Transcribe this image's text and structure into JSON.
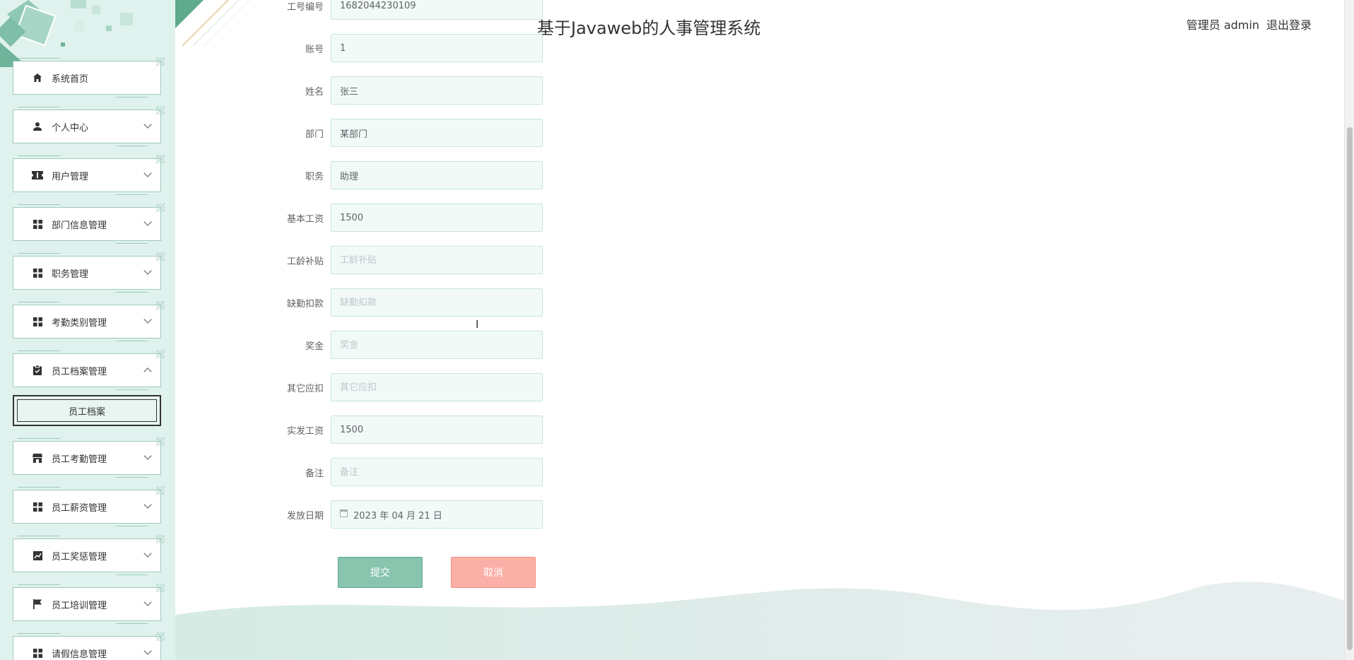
{
  "header": {
    "title": "基于Javaweb的人事管理系统",
    "user_label": "管理员 admin",
    "logout_label": "退出登录"
  },
  "sidebar": {
    "items": [
      {
        "label": "系统首页",
        "icon": "home-icon",
        "expanded": null
      },
      {
        "label": "个人中心",
        "icon": "user-icon",
        "expanded": false
      },
      {
        "label": "用户管理",
        "icon": "ticket-icon",
        "expanded": false
      },
      {
        "label": "部门信息管理",
        "icon": "grid-icon",
        "expanded": false
      },
      {
        "label": "职务管理",
        "icon": "grid-icon",
        "expanded": false
      },
      {
        "label": "考勤类别管理",
        "icon": "grid-icon",
        "expanded": false
      },
      {
        "label": "员工档案管理",
        "icon": "clipboard-icon",
        "expanded": true
      },
      {
        "label": "员工考勤管理",
        "icon": "shop-icon",
        "expanded": false
      },
      {
        "label": "员工薪资管理",
        "icon": "grid-icon",
        "expanded": false
      },
      {
        "label": "员工奖惩管理",
        "icon": "chart-icon",
        "expanded": false
      },
      {
        "label": "员工培训管理",
        "icon": "flag-icon",
        "expanded": false
      },
      {
        "label": "请假信息管理",
        "icon": "grid-icon",
        "expanded": false
      }
    ],
    "submenu": {
      "label": "员工档案"
    }
  },
  "form": {
    "fields": [
      {
        "label": "工号编号",
        "value": "1682044230109",
        "placeholder": ""
      },
      {
        "label": "账号",
        "value": "1",
        "placeholder": ""
      },
      {
        "label": "姓名",
        "value": "张三",
        "placeholder": ""
      },
      {
        "label": "部门",
        "value": "某部门",
        "placeholder": ""
      },
      {
        "label": "职务",
        "value": "助理",
        "placeholder": ""
      },
      {
        "label": "基本工资",
        "value": "1500",
        "placeholder": ""
      },
      {
        "label": "工龄补贴",
        "value": "",
        "placeholder": "工龄补贴"
      },
      {
        "label": "缺勤扣款",
        "value": "",
        "placeholder": "缺勤扣款"
      },
      {
        "label": "奖金",
        "value": "",
        "placeholder": "奖金"
      },
      {
        "label": "其它应扣",
        "value": "",
        "placeholder": "其它应扣"
      },
      {
        "label": "实发工资",
        "value": "1500",
        "placeholder": ""
      },
      {
        "label": "备注",
        "value": "",
        "placeholder": "备注"
      },
      {
        "label": "发放日期",
        "value": "2023 年 04 月 21 日",
        "placeholder": ""
      }
    ],
    "submit_label": "提交",
    "cancel_label": "取消"
  },
  "colors": {
    "sidebar_bg": "#e0f2ee",
    "accent": "#89c4ae",
    "cancel": "#fbb0a7"
  }
}
